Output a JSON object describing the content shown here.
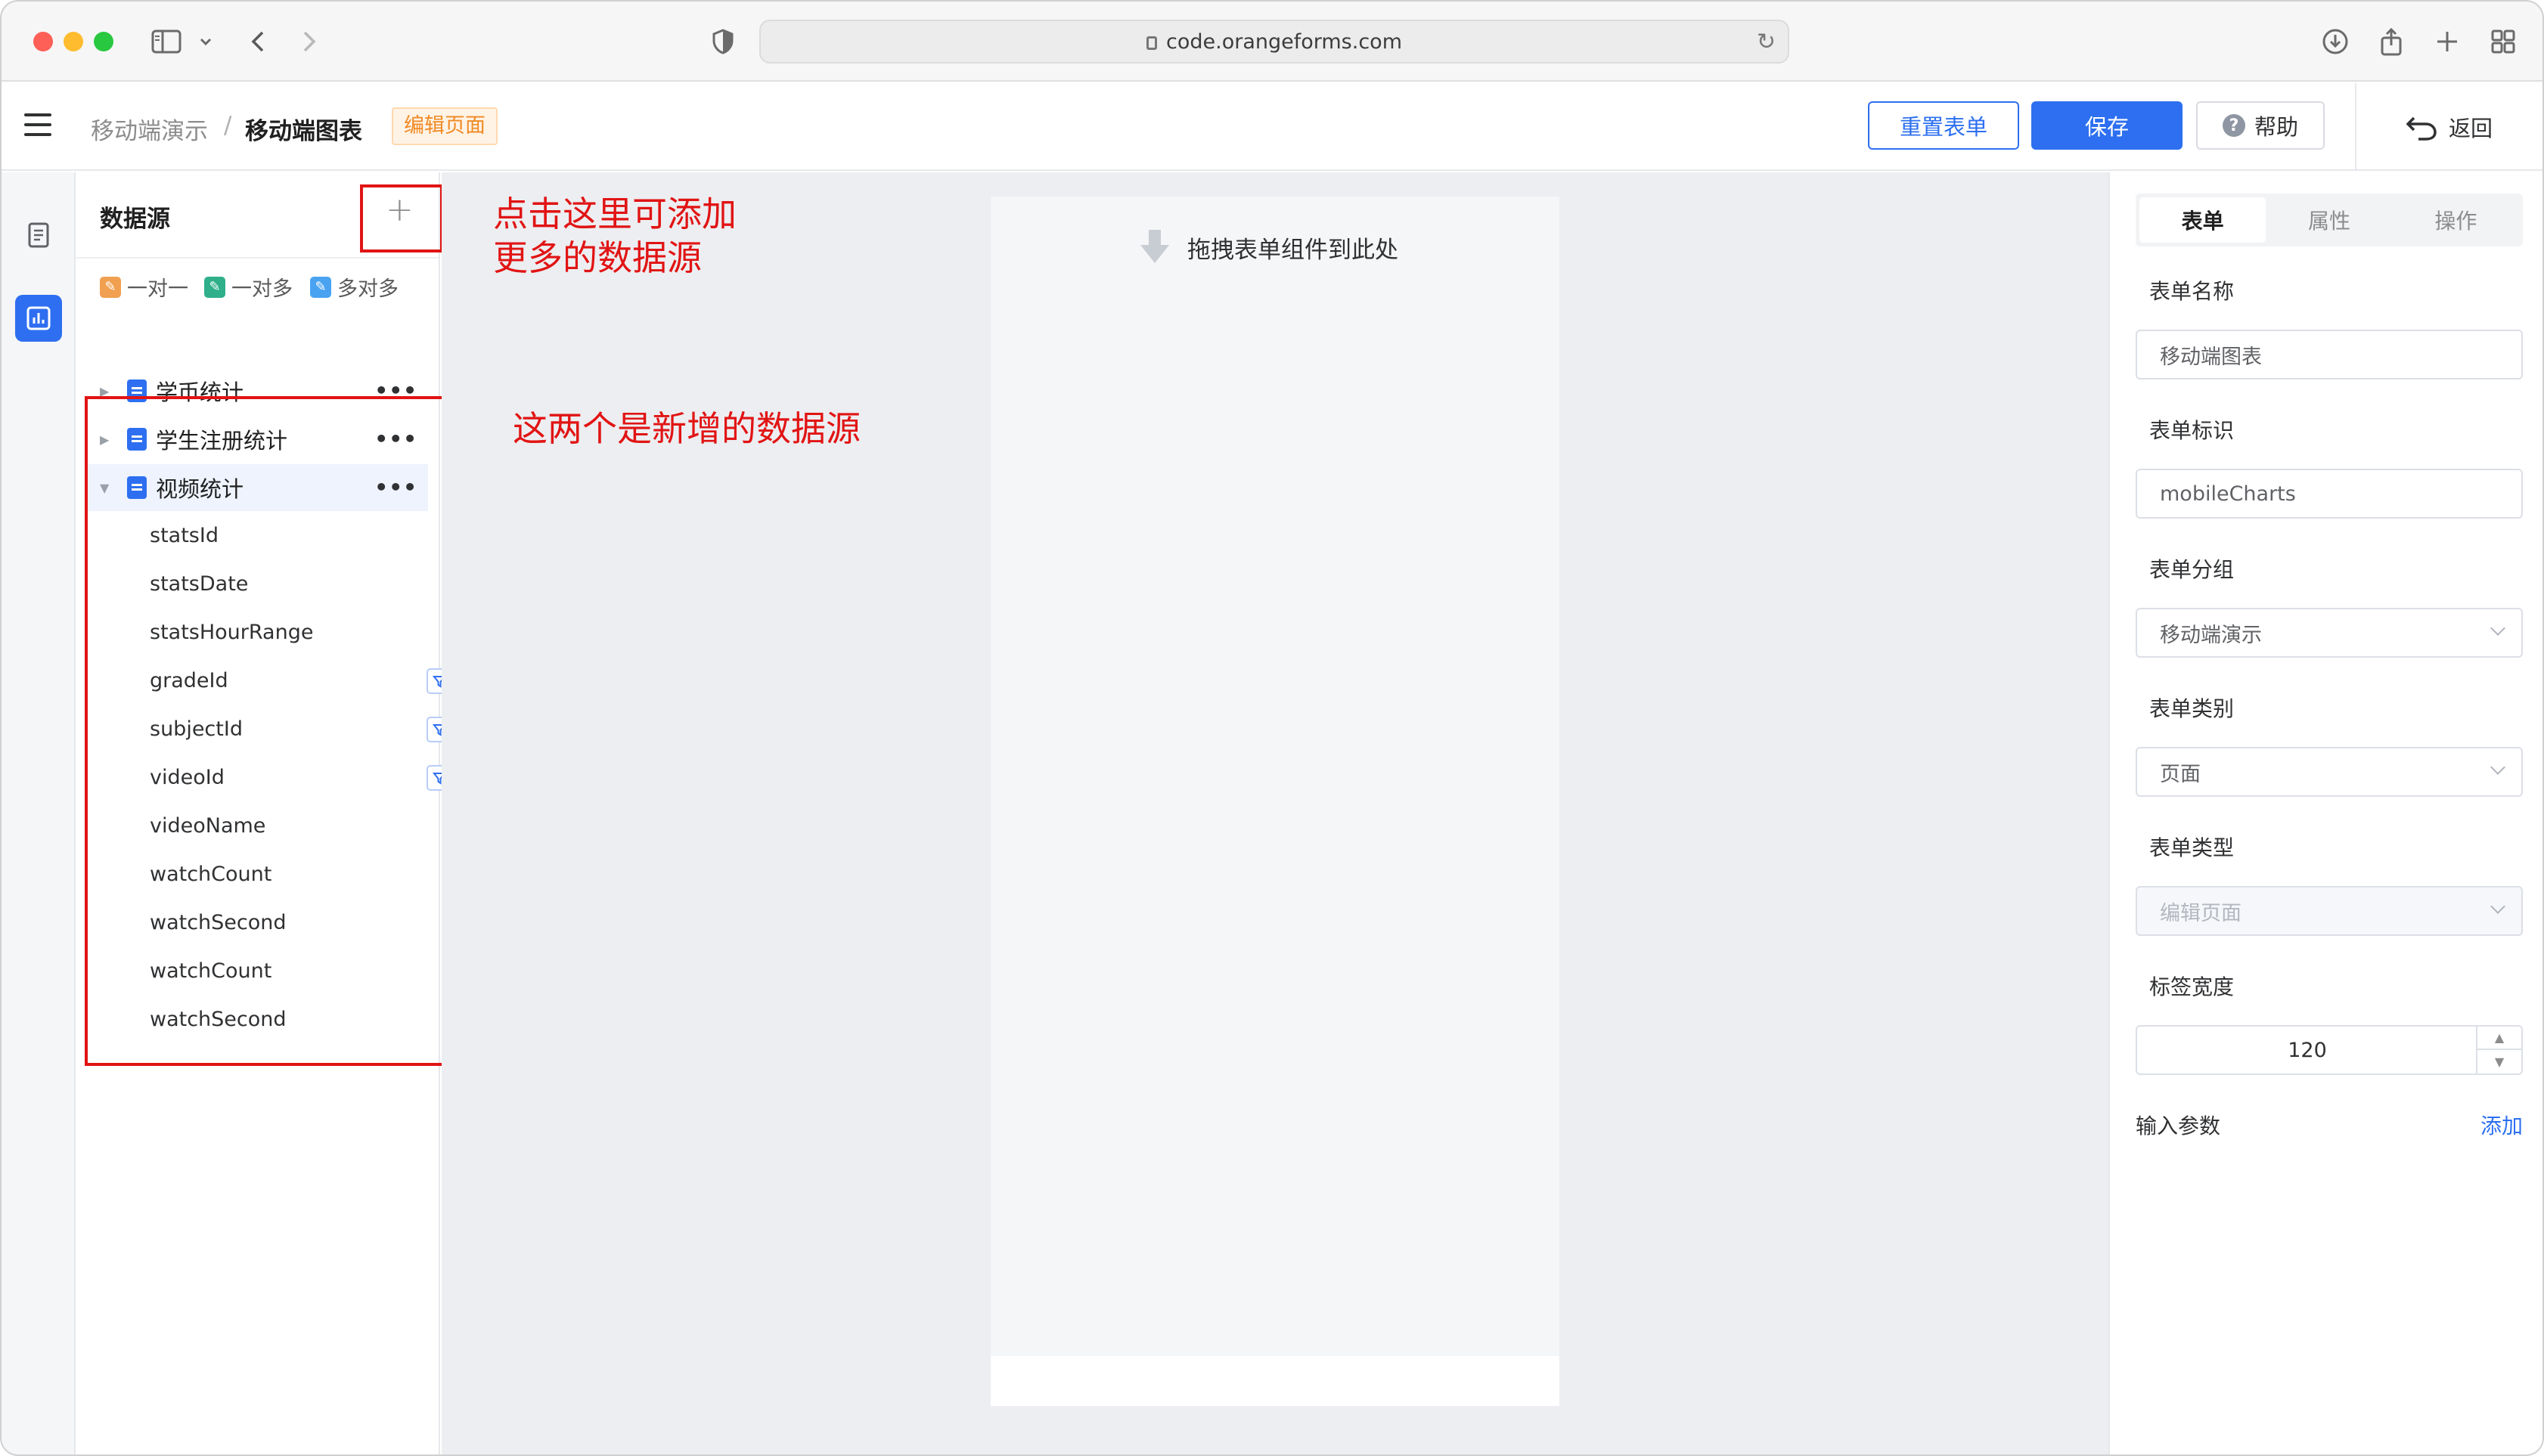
{
  "browser": {
    "url": "code.orangeforms.com"
  },
  "header": {
    "breadcrumb_parent": "移动端演示",
    "breadcrumb_separator": "/",
    "breadcrumb_current": "移动端图表",
    "mode_tag": "编辑页面",
    "reset_label": "重置表单",
    "save_label": "保存",
    "help_label": "帮助",
    "back_label": "返回"
  },
  "datasource": {
    "title": "数据源",
    "legend": [
      {
        "label": "一对一",
        "color": "#f0a050"
      },
      {
        "label": "一对多",
        "color": "#2fb08a"
      },
      {
        "label": "多对多",
        "color": "#4aa3f0"
      }
    ],
    "tree": [
      {
        "label": "学币统计",
        "expanded": false
      },
      {
        "label": "学生注册统计",
        "expanded": false
      },
      {
        "label": "视频统计",
        "expanded": true
      }
    ],
    "fields": [
      {
        "name": "statsId",
        "filter": false,
        "link": false
      },
      {
        "name": "statsDate",
        "filter": true,
        "link": false
      },
      {
        "name": "statsHourRange",
        "filter": false,
        "link": false
      },
      {
        "name": "gradeId",
        "filter": true,
        "link": true
      },
      {
        "name": "subjectId",
        "filter": true,
        "link": true
      },
      {
        "name": "videoId",
        "filter": true,
        "link": true
      },
      {
        "name": "videoName",
        "filter": false,
        "link": false
      },
      {
        "name": "watchCount",
        "filter": false,
        "link": false
      },
      {
        "name": "watchSecond",
        "filter": false,
        "link": false
      },
      {
        "name": "watchCount",
        "filter": false,
        "link": false
      },
      {
        "name": "watchSecond",
        "filter": false,
        "link": false
      }
    ]
  },
  "annotations": {
    "add_hint_line1": "点击这里可添加",
    "add_hint_line2": "更多的数据源",
    "new_sources_hint": "这两个是新增的数据源",
    "color": "#e11414"
  },
  "canvas": {
    "drop_hint": "拖拽表单组件到此处"
  },
  "properties": {
    "tabs": [
      "表单",
      "属性",
      "操作"
    ],
    "active_tab": "表单",
    "form_name_label": "表单名称",
    "form_name_value": "移动端图表",
    "form_id_label": "表单标识",
    "form_id_value": "mobileCharts",
    "form_group_label": "表单分组",
    "form_group_value": "移动端演示",
    "form_category_label": "表单类别",
    "form_category_value": "页面",
    "form_type_label": "表单类型",
    "form_type_value": "编辑页面",
    "label_width_label": "标签宽度",
    "label_width_value": "120",
    "input_params_label": "输入参数",
    "add_label": "添加"
  },
  "colors": {
    "primary": "#2d6ff0",
    "tag_orange": "#f08a24"
  }
}
